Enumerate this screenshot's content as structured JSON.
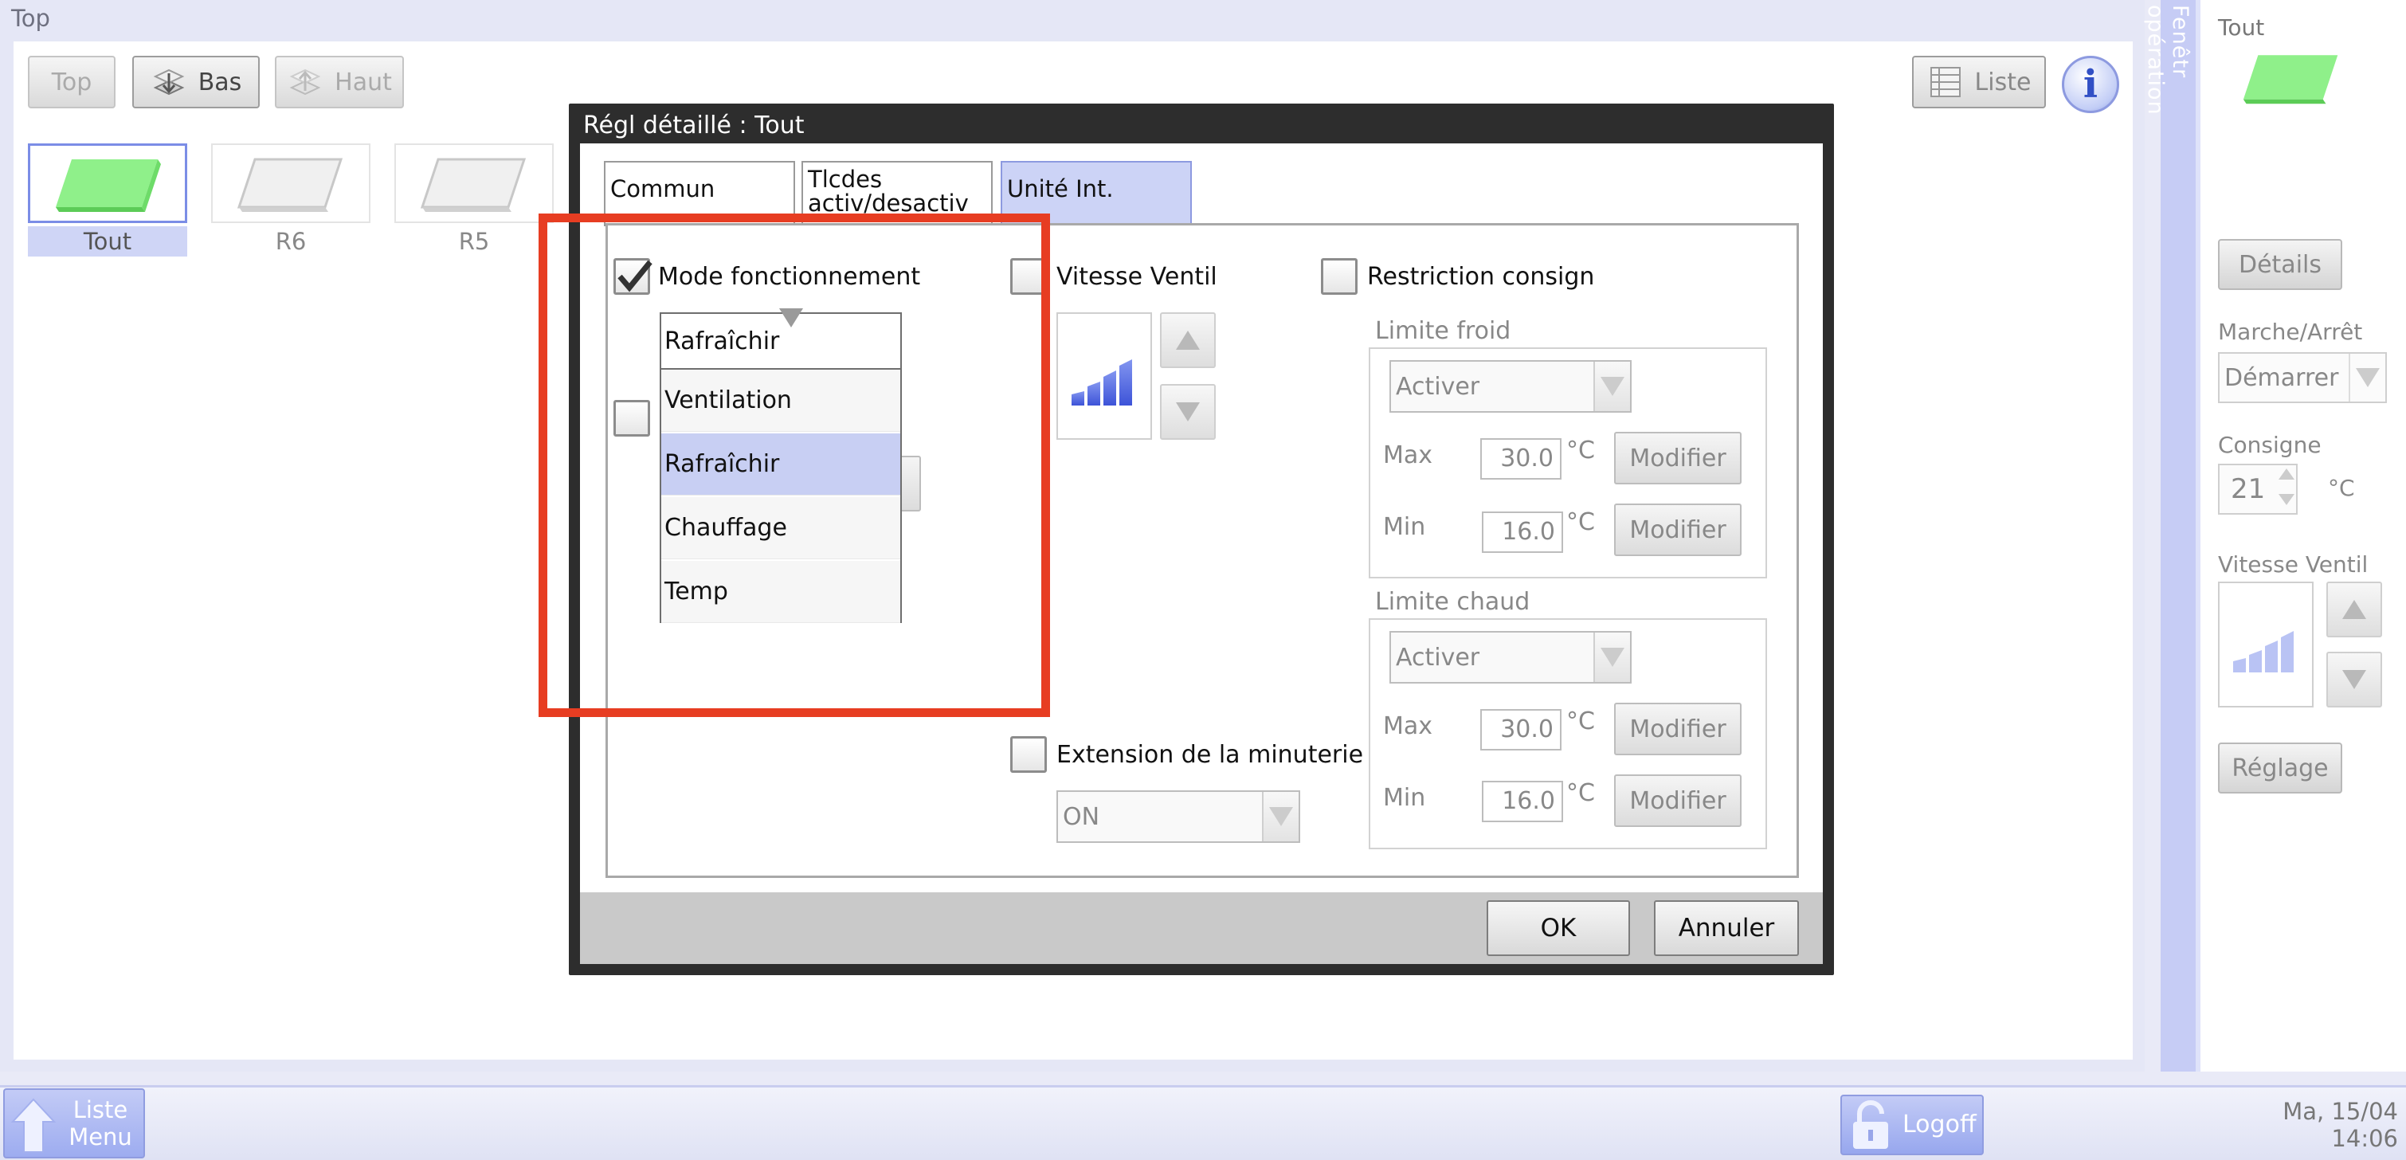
{
  "main": {
    "title": "Top",
    "toolbar": {
      "top_label": "Top",
      "bas_label": "Bas",
      "haut_label": "Haut",
      "liste_label": "Liste"
    },
    "areas": [
      {
        "label": "Tout",
        "selected": true
      },
      {
        "label": "R6",
        "selected": false
      },
      {
        "label": "R5",
        "selected": false
      }
    ]
  },
  "side_panel": {
    "strip_label": "Fenêtr opération",
    "area_name": "Tout",
    "details_label": "Détails",
    "onoff_label": "Marche/Arrêt",
    "onoff_value": "Démarrer",
    "consigne_label": "Consigne",
    "consigne_value": "21",
    "consigne_unit": "°C",
    "fan_label": "Vitesse Ventil",
    "reglage_label": "Réglage"
  },
  "taskbar": {
    "liste_menu_label_1": "Liste",
    "liste_menu_label_2": "Menu",
    "logoff_label": "Logoff",
    "date": "Ma, 15/04",
    "time": "14:06"
  },
  "dialog": {
    "title": "Régl détaillé : Tout",
    "tabs": [
      {
        "label": "Commun",
        "active": false
      },
      {
        "label": "Tlcdes activ/desactiv",
        "active": false
      },
      {
        "label": "Unité Int.",
        "active": true
      }
    ],
    "mode": {
      "label": "Mode fonctionnement",
      "checked": true,
      "selected": "Rafraîchir",
      "options": [
        "Ventilation",
        "Rafraîchir",
        "Chauffage",
        "Temp"
      ]
    },
    "fan": {
      "label": "Vitesse Ventil",
      "checked": false
    },
    "restriction": {
      "label": "Restriction consign",
      "checked": false,
      "cold": {
        "title": "Limite froid",
        "enable_value": "Activer",
        "max_label": "Max",
        "max_value": "30.0",
        "min_label": "Min",
        "min_value": "16.0",
        "unit": "°C",
        "modify_label": "Modifier"
      },
      "hot": {
        "title": "Limite chaud",
        "enable_value": "Activer",
        "max_label": "Max",
        "max_value": "30.0",
        "min_label": "Min",
        "min_value": "16.0",
        "unit": "°C",
        "modify_label": "Modifier"
      }
    },
    "timer_ext": {
      "label": "Extension de la minuterie",
      "checked": false,
      "value": "ON"
    },
    "ok_label": "OK",
    "cancel_label": "Annuler"
  },
  "colors": {
    "highlight": "#e73d22",
    "accent": "#8d9ae0",
    "selection": "#c8cff3"
  }
}
